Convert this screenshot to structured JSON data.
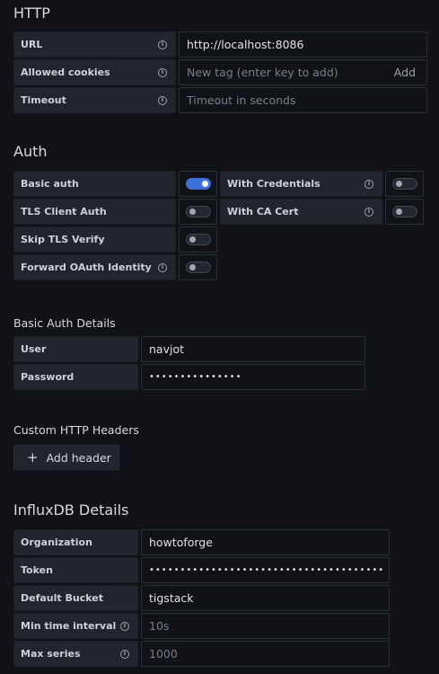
{
  "http": {
    "title": "HTTP",
    "url_label": "URL",
    "url_value": "http://localhost:8086",
    "cookies_label": "Allowed cookies",
    "cookies_placeholder": "New tag (enter key to add)",
    "cookies_add": "Add",
    "timeout_label": "Timeout",
    "timeout_placeholder": "Timeout in seconds"
  },
  "auth": {
    "title": "Auth",
    "basic_auth": "Basic auth",
    "with_credentials": "With Credentials",
    "tls_client_auth": "TLS Client Auth",
    "with_ca_cert": "With CA Cert",
    "skip_tls_verify": "Skip TLS Verify",
    "forward_oauth": "Forward OAuth Identity"
  },
  "basic_auth_details": {
    "title": "Basic Auth Details",
    "user_label": "User",
    "user_value": "navjot",
    "password_label": "Password",
    "password_value": "•••••••••••••••"
  },
  "custom_headers": {
    "title": "Custom HTTP Headers",
    "add_header": "Add header"
  },
  "influx": {
    "title": "InfluxDB Details",
    "org_label": "Organization",
    "org_value": "howtoforge",
    "token_label": "Token",
    "token_value": "••••••••••••••••••••••••••••••••••••••••••••••••••••",
    "bucket_label": "Default Bucket",
    "bucket_value": "tigstack",
    "min_interval_label": "Min time interval",
    "min_interval_placeholder": "10s",
    "max_series_label": "Max series",
    "max_series_placeholder": "1000"
  },
  "toggles": {
    "basic_auth": true,
    "with_credentials": false,
    "tls_client_auth": false,
    "with_ca_cert": false,
    "skip_tls_verify": false,
    "forward_oauth": false
  },
  "colors": {
    "background": "#111217",
    "toggle_on": "#3d71d9"
  }
}
